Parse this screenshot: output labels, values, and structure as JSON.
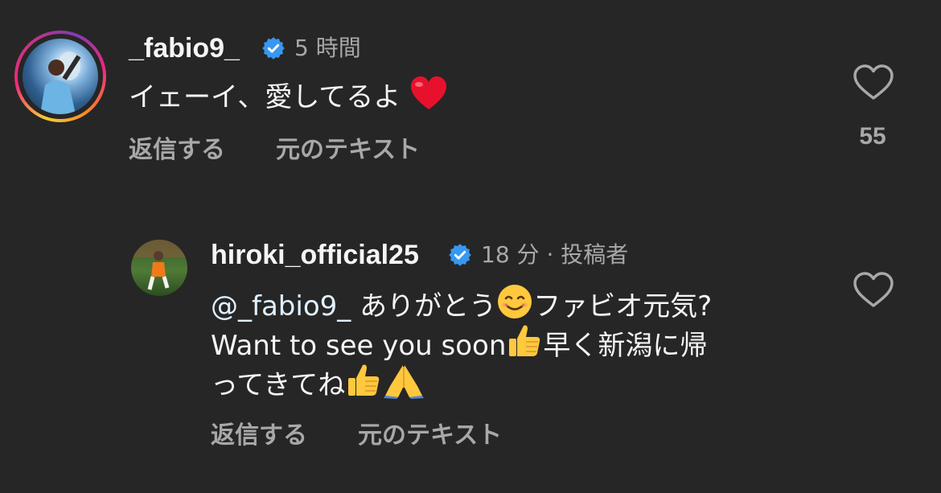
{
  "comment": {
    "username": "_fabio9_",
    "time": "5 時間",
    "text": "イェーイ、愛してるよ",
    "text_emoji": "heart-emoji",
    "reply_label": "返信する",
    "original_label": "元のテキスト",
    "like_count": "55"
  },
  "reply": {
    "username": "hiroki_official25",
    "time": "18 分",
    "separator": "·",
    "author_badge": "投稿者",
    "mention": "@_fabio9_",
    "line1_a": "ありがとう",
    "line1_b": "ファビオ元気?",
    "line2_a": "Want to see you soon",
    "line2_b": "早く新潟に帰",
    "line3_a": "ってきてね",
    "emojis": [
      "smiling-face-emoji",
      "thumbs-up-emoji",
      "thumbs-up-emoji",
      "folded-hands-emoji"
    ],
    "reply_label": "返信する",
    "original_label": "元のテキスト"
  },
  "colors": {
    "background": "#262626",
    "text": "#f5f5f5",
    "secondary": "#a8a8a8",
    "verified": "#3897f0",
    "heart": "#e8112d"
  }
}
